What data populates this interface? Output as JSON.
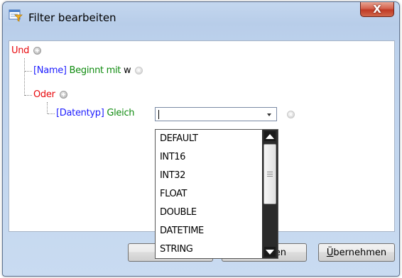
{
  "window": {
    "title": "Filter bearbeiten",
    "close_glyph": "X",
    "icon": "filter-list-icon"
  },
  "tree": {
    "root": {
      "label": "Und"
    },
    "name_condition": {
      "field": "[Name]",
      "operator": "Beginnt mit",
      "value": "w"
    },
    "or_group": {
      "label": "Oder"
    },
    "type_condition": {
      "field": "[Datentyp]",
      "operator": "Gleich",
      "value": ""
    }
  },
  "dropdown": {
    "options": [
      "DEFAULT",
      "INT16",
      "INT32",
      "FLOAT",
      "DOUBLE",
      "DATETIME",
      "STRING"
    ]
  },
  "buttons": {
    "left_partial": "l",
    "middle_partial": "en",
    "apply_first": "Ü",
    "apply_rest": "bernehmen"
  },
  "colors": {
    "logic": "#e8080c",
    "field": "#1d1dff",
    "operator": "#0f8b0f"
  }
}
